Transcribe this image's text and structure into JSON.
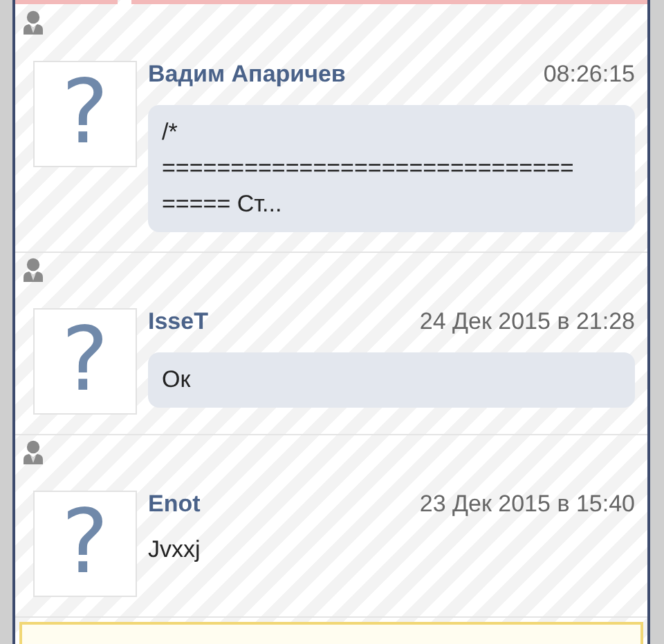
{
  "messages": [
    {
      "kind": "bubble",
      "avatar": "?",
      "author": "Вадим Апаричев",
      "time": "08:26:15",
      "text": "/*\n==============================\n===== Ст..."
    },
    {
      "kind": "bubble",
      "avatar": "?",
      "author": "IsseT",
      "time": "24 Дек 2015 в 21:28",
      "text": "Ок"
    },
    {
      "kind": "plain",
      "avatar": "?",
      "author": "Enot",
      "time": "23 Дек 2015 в 15:40",
      "text": "Jvxxj"
    }
  ]
}
